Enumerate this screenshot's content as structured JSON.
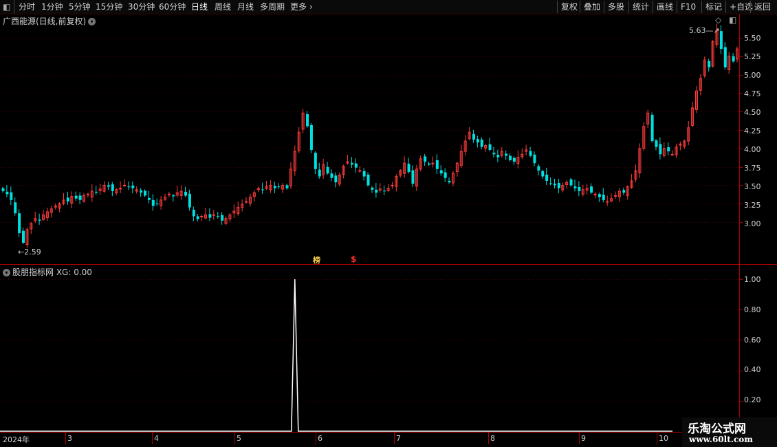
{
  "toolbar": {
    "periods": [
      "分时",
      "1分钟",
      "5分钟",
      "15分钟",
      "30分钟",
      "60分钟",
      "日线",
      "周线",
      "月线",
      "多周期",
      "更多"
    ],
    "active_period": "日线",
    "right_buttons": [
      "复权",
      "叠加",
      "多股",
      "统计",
      "画线",
      "F10",
      "标记",
      "+自选",
      "返回"
    ]
  },
  "price_panel": {
    "title": "广西能源(日线,前复权)",
    "max_marker": "5.63",
    "min_marker": "2.59",
    "event_markers": [
      "榜",
      "$"
    ]
  },
  "indicator_panel": {
    "title": "股朋指标网 XG: 0.00"
  },
  "watermark": {
    "line1": "乐淘公式网",
    "line2": "www.60lt.com"
  },
  "colors": {
    "up": "#ff3c3c",
    "down": "#00e0e0",
    "grid": "#4a0000",
    "axis": "#b00000",
    "signal": "#ffffff",
    "marker_bang": "#ffd24a"
  },
  "chart_data": [
    {
      "type": "candlestick",
      "title": "广西能源(日线,前复权)",
      "y_ticks": [
        "5.50",
        "5.25",
        "5.00",
        "4.75",
        "4.50",
        "4.25",
        "4.00",
        "3.75",
        "3.50",
        "3.25",
        "3.00"
      ],
      "ylim": [
        2.45,
        5.82
      ],
      "x_ticks": [
        "2024年",
        "3",
        "4",
        "5",
        "6",
        "7",
        "8",
        "9",
        "10"
      ],
      "annotations": [
        {
          "label": "5.63",
          "type": "high"
        },
        {
          "label": "2.59",
          "type": "low"
        }
      ],
      "close": [
        3.42,
        3.38,
        3.3,
        3.12,
        2.85,
        2.72,
        2.9,
        2.98,
        3.05,
        3.02,
        3.1,
        3.14,
        3.18,
        3.22,
        3.25,
        3.3,
        3.28,
        3.35,
        3.32,
        3.3,
        3.36,
        3.38,
        3.42,
        3.4,
        3.45,
        3.5,
        3.48,
        3.42,
        3.44,
        3.46,
        3.5,
        3.48,
        3.46,
        3.44,
        3.4,
        3.36,
        3.3,
        3.22,
        3.25,
        3.3,
        3.34,
        3.38,
        3.35,
        3.4,
        3.42,
        3.36,
        3.2,
        3.08,
        3.04,
        3.08,
        3.1,
        3.06,
        3.1,
        3.08,
        3.02,
        3.05,
        3.1,
        3.15,
        3.2,
        3.24,
        3.28,
        3.34,
        3.4,
        3.46,
        3.44,
        3.48,
        3.5,
        3.46,
        3.48,
        3.5,
        3.46,
        3.72,
        3.96,
        4.22,
        4.48,
        4.3,
        3.98,
        3.72,
        3.62,
        3.78,
        3.66,
        3.6,
        3.54,
        3.64,
        3.76,
        3.82,
        3.78,
        3.74,
        3.7,
        3.62,
        3.5,
        3.44,
        3.4,
        3.45,
        3.42,
        3.46,
        3.5,
        3.62,
        3.7,
        3.8,
        3.68,
        3.52,
        3.72,
        3.86,
        3.82,
        3.78,
        3.8,
        3.72,
        3.66,
        3.6,
        3.54,
        3.66,
        3.8,
        3.96,
        4.1,
        4.22,
        4.12,
        4.08,
        4.02,
        4.04,
        3.98,
        3.92,
        3.88,
        3.96,
        3.9,
        3.84,
        3.82,
        3.88,
        3.92,
        3.98,
        3.9,
        3.8,
        3.7,
        3.62,
        3.56,
        3.52,
        3.5,
        3.46,
        3.5,
        3.54,
        3.5,
        3.46,
        3.42,
        3.44,
        3.46,
        3.4,
        3.38,
        3.34,
        3.3,
        3.28,
        3.32,
        3.36,
        3.42,
        3.4,
        3.48,
        3.56,
        3.7,
        4.0,
        4.3,
        4.48,
        4.1,
        4.02,
        3.92,
        4.0,
        3.96,
        3.92,
        4.02,
        4.06,
        4.1,
        4.28,
        4.55,
        4.78,
        4.95,
        5.2,
        5.1,
        5.45,
        5.6,
        5.35,
        5.1,
        5.25,
        5.18,
        5.35
      ]
    },
    {
      "type": "line",
      "title": "股朋指标网 XG: 0.00",
      "series": [
        {
          "name": "XG",
          "signal_index": 72,
          "value_at_signal": 1.0,
          "baseline": 0.0
        }
      ],
      "y_ticks": [
        "1.00",
        "0.80",
        "0.60",
        "0.40",
        "0.20"
      ],
      "ylim": [
        0,
        1.05
      ]
    }
  ]
}
